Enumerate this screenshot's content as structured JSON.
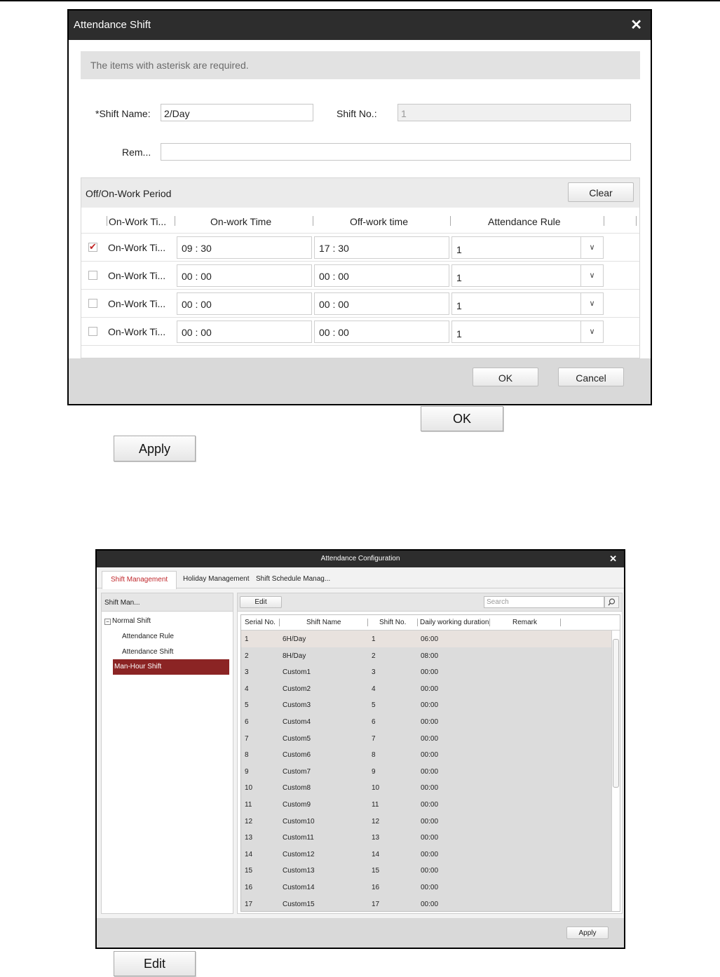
{
  "attendance_shift_dialog": {
    "title": "Attendance Shift",
    "notice": "The items with asterisk are required.",
    "shift_name_label": "*Shift Name:",
    "shift_name_value": "2/Day",
    "shift_no_label": "Shift No.:",
    "shift_no_value": "1",
    "remark_label": "Rem...",
    "remark_value": "",
    "period_title": "Off/On-Work Period",
    "clear_label": "Clear",
    "columns": [
      "On-Work Ti...",
      "On-work Time",
      "Off-work time",
      "Attendance Rule"
    ],
    "rows": [
      {
        "name": "On-Work Ti...",
        "on": "09 : 30",
        "off": "17 : 30",
        "rule": "1",
        "checked": true
      },
      {
        "name": "On-Work Ti...",
        "on": "00 : 00",
        "off": "00 : 00",
        "rule": "1",
        "checked": false
      },
      {
        "name": "On-Work Ti...",
        "on": "00 : 00",
        "off": "00 : 00",
        "rule": "1",
        "checked": false
      },
      {
        "name": "On-Work Ti...",
        "on": "00 : 00",
        "off": "00 : 00",
        "rule": "1",
        "checked": false
      }
    ],
    "ok_label": "OK",
    "cancel_label": "Cancel"
  },
  "standalone_buttons": {
    "ok": "OK",
    "apply": "Apply",
    "edit": "Edit"
  },
  "attendance_config_dialog": {
    "title": "Attendance Configuration",
    "tabs": [
      "Shift Management",
      "Holiday Management",
      "Shift Schedule Manag..."
    ],
    "left_header": "Shift Man...",
    "tree": {
      "root": "Normal Shift",
      "children": [
        "Attendance Rule",
        "Attendance Shift"
      ],
      "selected": "Man-Hour Shift"
    },
    "edit_label": "Edit",
    "search_placeholder": "Search",
    "columns": [
      "Serial No.",
      "Shift Name",
      "Shift No.",
      "Daily working duration",
      "Remark"
    ],
    "rows": [
      {
        "serial": "1",
        "name": "6H/Day",
        "no": "1",
        "duration": "06:00"
      },
      {
        "serial": "2",
        "name": "8H/Day",
        "no": "2",
        "duration": "08:00"
      },
      {
        "serial": "3",
        "name": "Custom1",
        "no": "3",
        "duration": "00:00"
      },
      {
        "serial": "4",
        "name": "Custom2",
        "no": "4",
        "duration": "00:00"
      },
      {
        "serial": "5",
        "name": "Custom3",
        "no": "5",
        "duration": "00:00"
      },
      {
        "serial": "6",
        "name": "Custom4",
        "no": "6",
        "duration": "00:00"
      },
      {
        "serial": "7",
        "name": "Custom5",
        "no": "7",
        "duration": "00:00"
      },
      {
        "serial": "8",
        "name": "Custom6",
        "no": "8",
        "duration": "00:00"
      },
      {
        "serial": "9",
        "name": "Custom7",
        "no": "9",
        "duration": "00:00"
      },
      {
        "serial": "10",
        "name": "Custom8",
        "no": "10",
        "duration": "00:00"
      },
      {
        "serial": "11",
        "name": "Custom9",
        "no": "11",
        "duration": "00:00"
      },
      {
        "serial": "12",
        "name": "Custom10",
        "no": "12",
        "duration": "00:00"
      },
      {
        "serial": "13",
        "name": "Custom11",
        "no": "13",
        "duration": "00:00"
      },
      {
        "serial": "14",
        "name": "Custom12",
        "no": "14",
        "duration": "00:00"
      },
      {
        "serial": "15",
        "name": "Custom13",
        "no": "15",
        "duration": "00:00"
      },
      {
        "serial": "16",
        "name": "Custom14",
        "no": "16",
        "duration": "00:00"
      },
      {
        "serial": "17",
        "name": "Custom15",
        "no": "17",
        "duration": "00:00"
      }
    ],
    "apply_label": "Apply"
  },
  "colors": {
    "titlebar": "#2d2d2d",
    "accent_red": "#c0282c",
    "selected_item": "#8b2424"
  },
  "icons": {
    "close": "close-icon",
    "dropdown": "chevron-down-icon",
    "search": "search-icon",
    "check": "checkmark-icon",
    "tree_toggle": "collapse-icon"
  }
}
